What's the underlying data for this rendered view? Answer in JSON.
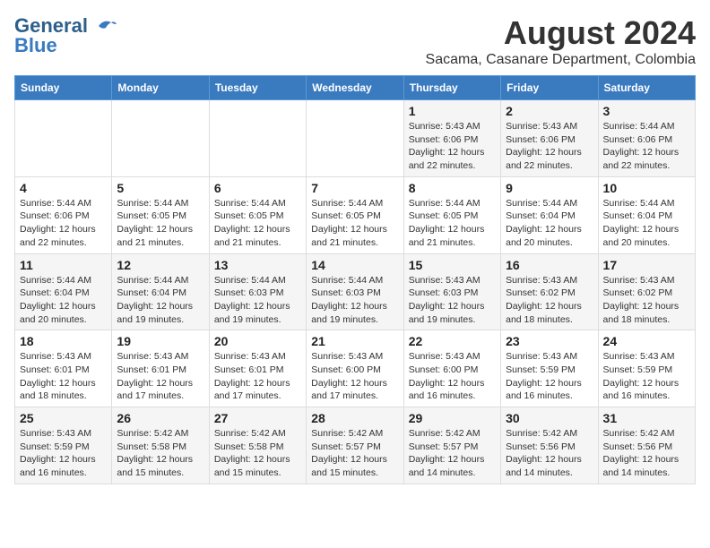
{
  "logo": {
    "line1": "General",
    "line2": "Blue"
  },
  "title": "August 2024",
  "subtitle": "Sacama, Casanare Department, Colombia",
  "days_of_week": [
    "Sunday",
    "Monday",
    "Tuesday",
    "Wednesday",
    "Thursday",
    "Friday",
    "Saturday"
  ],
  "weeks": [
    [
      {
        "day": "",
        "detail": ""
      },
      {
        "day": "",
        "detail": ""
      },
      {
        "day": "",
        "detail": ""
      },
      {
        "day": "",
        "detail": ""
      },
      {
        "day": "1",
        "detail": "Sunrise: 5:43 AM\nSunset: 6:06 PM\nDaylight: 12 hours\nand 22 minutes."
      },
      {
        "day": "2",
        "detail": "Sunrise: 5:43 AM\nSunset: 6:06 PM\nDaylight: 12 hours\nand 22 minutes."
      },
      {
        "day": "3",
        "detail": "Sunrise: 5:44 AM\nSunset: 6:06 PM\nDaylight: 12 hours\nand 22 minutes."
      }
    ],
    [
      {
        "day": "4",
        "detail": "Sunrise: 5:44 AM\nSunset: 6:06 PM\nDaylight: 12 hours\nand 22 minutes."
      },
      {
        "day": "5",
        "detail": "Sunrise: 5:44 AM\nSunset: 6:05 PM\nDaylight: 12 hours\nand 21 minutes."
      },
      {
        "day": "6",
        "detail": "Sunrise: 5:44 AM\nSunset: 6:05 PM\nDaylight: 12 hours\nand 21 minutes."
      },
      {
        "day": "7",
        "detail": "Sunrise: 5:44 AM\nSunset: 6:05 PM\nDaylight: 12 hours\nand 21 minutes."
      },
      {
        "day": "8",
        "detail": "Sunrise: 5:44 AM\nSunset: 6:05 PM\nDaylight: 12 hours\nand 21 minutes."
      },
      {
        "day": "9",
        "detail": "Sunrise: 5:44 AM\nSunset: 6:04 PM\nDaylight: 12 hours\nand 20 minutes."
      },
      {
        "day": "10",
        "detail": "Sunrise: 5:44 AM\nSunset: 6:04 PM\nDaylight: 12 hours\nand 20 minutes."
      }
    ],
    [
      {
        "day": "11",
        "detail": "Sunrise: 5:44 AM\nSunset: 6:04 PM\nDaylight: 12 hours\nand 20 minutes."
      },
      {
        "day": "12",
        "detail": "Sunrise: 5:44 AM\nSunset: 6:04 PM\nDaylight: 12 hours\nand 19 minutes."
      },
      {
        "day": "13",
        "detail": "Sunrise: 5:44 AM\nSunset: 6:03 PM\nDaylight: 12 hours\nand 19 minutes."
      },
      {
        "day": "14",
        "detail": "Sunrise: 5:44 AM\nSunset: 6:03 PM\nDaylight: 12 hours\nand 19 minutes."
      },
      {
        "day": "15",
        "detail": "Sunrise: 5:43 AM\nSunset: 6:03 PM\nDaylight: 12 hours\nand 19 minutes."
      },
      {
        "day": "16",
        "detail": "Sunrise: 5:43 AM\nSunset: 6:02 PM\nDaylight: 12 hours\nand 18 minutes."
      },
      {
        "day": "17",
        "detail": "Sunrise: 5:43 AM\nSunset: 6:02 PM\nDaylight: 12 hours\nand 18 minutes."
      }
    ],
    [
      {
        "day": "18",
        "detail": "Sunrise: 5:43 AM\nSunset: 6:01 PM\nDaylight: 12 hours\nand 18 minutes."
      },
      {
        "day": "19",
        "detail": "Sunrise: 5:43 AM\nSunset: 6:01 PM\nDaylight: 12 hours\nand 17 minutes."
      },
      {
        "day": "20",
        "detail": "Sunrise: 5:43 AM\nSunset: 6:01 PM\nDaylight: 12 hours\nand 17 minutes."
      },
      {
        "day": "21",
        "detail": "Sunrise: 5:43 AM\nSunset: 6:00 PM\nDaylight: 12 hours\nand 17 minutes."
      },
      {
        "day": "22",
        "detail": "Sunrise: 5:43 AM\nSunset: 6:00 PM\nDaylight: 12 hours\nand 16 minutes."
      },
      {
        "day": "23",
        "detail": "Sunrise: 5:43 AM\nSunset: 5:59 PM\nDaylight: 12 hours\nand 16 minutes."
      },
      {
        "day": "24",
        "detail": "Sunrise: 5:43 AM\nSunset: 5:59 PM\nDaylight: 12 hours\nand 16 minutes."
      }
    ],
    [
      {
        "day": "25",
        "detail": "Sunrise: 5:43 AM\nSunset: 5:59 PM\nDaylight: 12 hours\nand 16 minutes."
      },
      {
        "day": "26",
        "detail": "Sunrise: 5:42 AM\nSunset: 5:58 PM\nDaylight: 12 hours\nand 15 minutes."
      },
      {
        "day": "27",
        "detail": "Sunrise: 5:42 AM\nSunset: 5:58 PM\nDaylight: 12 hours\nand 15 minutes."
      },
      {
        "day": "28",
        "detail": "Sunrise: 5:42 AM\nSunset: 5:57 PM\nDaylight: 12 hours\nand 15 minutes."
      },
      {
        "day": "29",
        "detail": "Sunrise: 5:42 AM\nSunset: 5:57 PM\nDaylight: 12 hours\nand 14 minutes."
      },
      {
        "day": "30",
        "detail": "Sunrise: 5:42 AM\nSunset: 5:56 PM\nDaylight: 12 hours\nand 14 minutes."
      },
      {
        "day": "31",
        "detail": "Sunrise: 5:42 AM\nSunset: 5:56 PM\nDaylight: 12 hours\nand 14 minutes."
      }
    ]
  ]
}
